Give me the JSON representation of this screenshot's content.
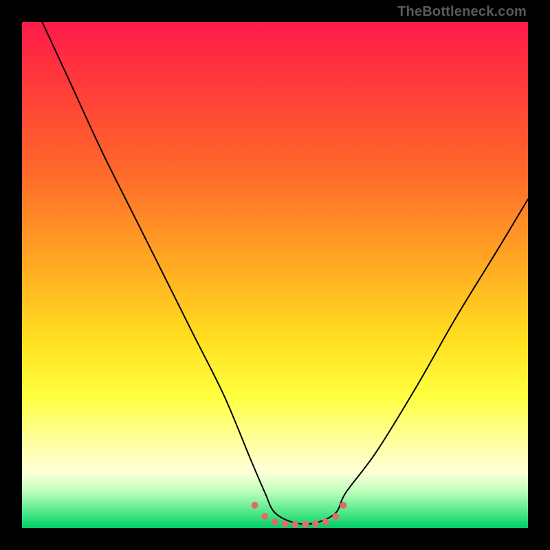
{
  "watermark": "TheBottleneck.com",
  "chart_data": {
    "type": "line",
    "title": "",
    "xlabel": "",
    "ylabel": "",
    "xlim": [
      0,
      100
    ],
    "ylim": [
      0,
      100
    ],
    "grid": false,
    "legend": false,
    "series": [
      {
        "name": "bottleneck-curve",
        "color": "#000000",
        "x": [
          4,
          10,
          16,
          22,
          28,
          34,
          40,
          45,
          48,
          50,
          54,
          58,
          62,
          64,
          70,
          78,
          86,
          94,
          100
        ],
        "y": [
          100,
          87,
          74,
          62,
          50,
          38,
          26,
          14,
          7,
          3,
          1,
          1,
          3,
          7,
          15,
          28,
          42,
          55,
          65
        ]
      }
    ],
    "markers": {
      "name": "valley-markers",
      "color": "#e06b6b",
      "radius": 5,
      "x": [
        46,
        48,
        50,
        52,
        54,
        56,
        58,
        60,
        62,
        63.5
      ],
      "y": [
        4.5,
        2.3,
        1.2,
        0.8,
        0.7,
        0.7,
        0.8,
        1.2,
        2.3,
        4.5
      ]
    }
  }
}
